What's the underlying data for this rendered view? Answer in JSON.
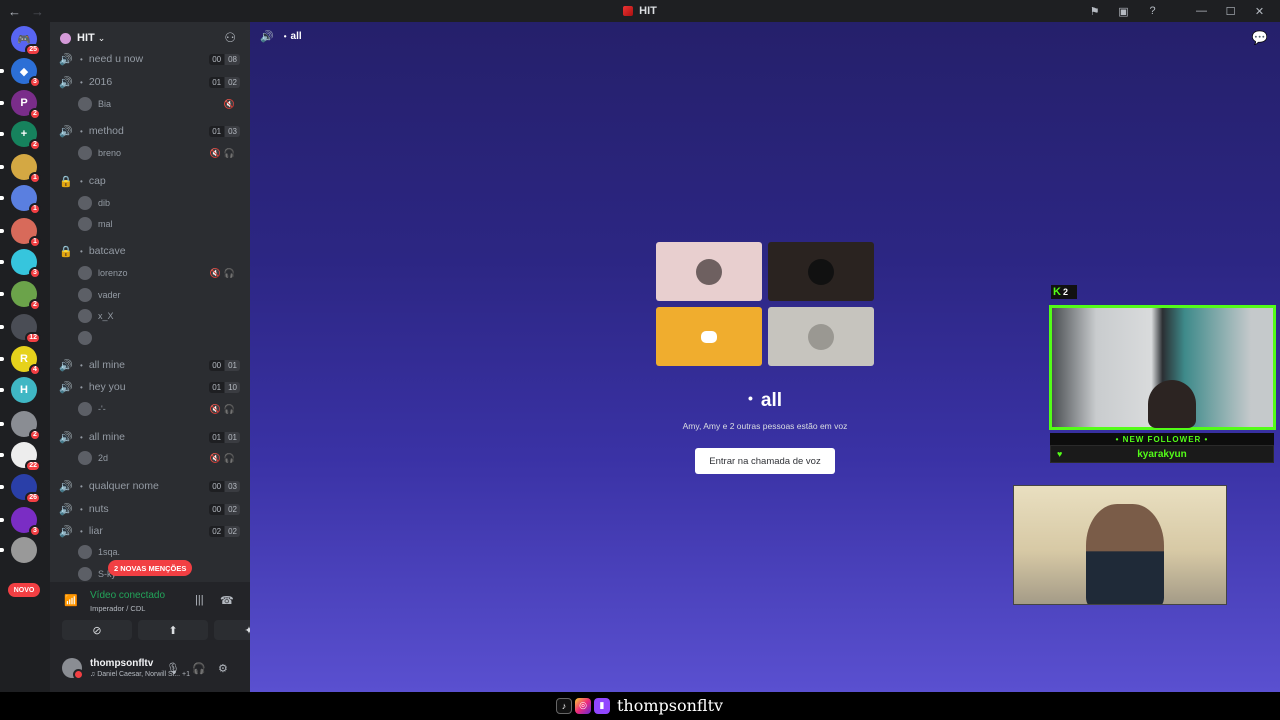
{
  "titlebar": {
    "back": "←",
    "forward": "→",
    "title": "HIT",
    "icons": [
      "inbox-flag-icon",
      "screen-icon",
      "help-icon"
    ],
    "window_controls": [
      "—",
      "☐",
      "✕"
    ]
  },
  "rail": {
    "servers": [
      {
        "name": "dm-home",
        "badge": "25",
        "color": "#5865f2",
        "glyph": "🎮"
      },
      {
        "name": "server-blue-diamond",
        "badge": "3",
        "color": "#2c6fd6",
        "glyph": "◆"
      },
      {
        "name": "server-p",
        "badge": "2",
        "color": "#7a2d8a",
        "glyph": "P"
      },
      {
        "name": "server-plus",
        "badge": "2",
        "color": "#16825d",
        "glyph": "+"
      },
      {
        "name": "server-anime-1",
        "badge": "1",
        "color": "#d4a843",
        "glyph": ""
      },
      {
        "name": "server-anime-2",
        "badge": "1",
        "color": "#5a7fe0",
        "glyph": ""
      },
      {
        "name": "server-anime-3",
        "badge": "1",
        "color": "#d86a5a",
        "glyph": ""
      },
      {
        "name": "server-cyan",
        "badge": "3",
        "color": "#36c5dd",
        "glyph": ""
      },
      {
        "name": "server-turtle",
        "badge": "2",
        "color": "#6ba34a",
        "glyph": ""
      },
      {
        "name": "server-car",
        "badge": "12",
        "color": "#4a4d55",
        "glyph": ""
      },
      {
        "name": "server-yellow-r",
        "badge": "4",
        "color": "#e6d21c",
        "glyph": "R"
      },
      {
        "name": "server-historia",
        "badge": "",
        "color": "#3fb7c4",
        "glyph": "H"
      },
      {
        "name": "server-grey",
        "badge": "2",
        "color": "#8a8d93",
        "glyph": ""
      },
      {
        "name": "server-skull",
        "badge": "22",
        "color": "#ededed",
        "glyph": ""
      },
      {
        "name": "server-mario",
        "badge": "26",
        "color": "#2a3fa8",
        "glyph": ""
      },
      {
        "name": "server-purple",
        "badge": "3",
        "color": "#7a2dc4",
        "glyph": ""
      },
      {
        "name": "server-novo",
        "badge": "",
        "color": "#999",
        "glyph": ""
      }
    ],
    "novo_label": "NOVO"
  },
  "sidebar": {
    "server_name": "HIT",
    "channels": [
      {
        "type": "voice",
        "name": "need u now",
        "counts": [
          "00",
          "08"
        ],
        "live": false
      },
      {
        "type": "voice",
        "name": "2016",
        "counts": [
          "01",
          "02"
        ],
        "live": true
      },
      {
        "type": "user",
        "name": "Bia",
        "icons": "🔇"
      },
      {
        "type": "voice",
        "name": "method",
        "counts": [
          "01",
          "03"
        ],
        "live": true
      },
      {
        "type": "user",
        "name": "breno",
        "icons": "🔇🎧"
      },
      {
        "type": "locked",
        "name": "cap"
      },
      {
        "type": "user",
        "name": "dib",
        "icons": ""
      },
      {
        "type": "user",
        "name": "mal",
        "icons": ""
      },
      {
        "type": "locked",
        "name": "batcave"
      },
      {
        "type": "user",
        "name": "lorenzo",
        "icons": "🔇🎧"
      },
      {
        "type": "user",
        "name": "vader",
        "icons": ""
      },
      {
        "type": "user",
        "name": "x_X",
        "icons": ""
      },
      {
        "type": "user",
        "name": "",
        "icons": ""
      },
      {
        "type": "voice",
        "name": "all mine",
        "counts": [
          "00",
          "01"
        ],
        "live": false
      },
      {
        "type": "voice",
        "name": "hey you",
        "counts": [
          "01",
          "10"
        ],
        "live": true
      },
      {
        "type": "user",
        "name": "-'-",
        "icons": "🔇🎧"
      },
      {
        "type": "voice",
        "name": "all mine",
        "counts": [
          "01",
          "01"
        ],
        "live": true
      },
      {
        "type": "user",
        "name": "2d",
        "icons": "🔇🎧"
      },
      {
        "type": "voice",
        "name": "qualquer nome",
        "counts": [
          "00",
          "03"
        ],
        "live": false
      },
      {
        "type": "voice",
        "name": "nuts",
        "counts": [
          "00",
          "02"
        ],
        "live": false
      },
      {
        "type": "voice",
        "name": "liar",
        "counts": [
          "02",
          "02"
        ],
        "live": true
      },
      {
        "type": "user",
        "name": "1sqa.",
        "icons": ""
      },
      {
        "type": "user",
        "name": "S-ky",
        "icons": ""
      }
    ],
    "mentions_label": "2 NOVAS MENÇÕES"
  },
  "voice_panel": {
    "status": "Vídeo conectado",
    "location": "Imperador / CDL"
  },
  "userbar": {
    "username": "thompsonfltv",
    "activity": "Daniel Caesar, Norwill Si...",
    "activity_extra": "+1"
  },
  "stage": {
    "channel_name": "all",
    "call_title": "all",
    "call_subtitle": "Amy, Amy e 2 outras pessoas estão em voz",
    "join_label": "Entrar na chamada de voz",
    "tiles": [
      {
        "name": "participant-tile-1",
        "bg": "#e8cfcf",
        "avatar": "#6e6060"
      },
      {
        "name": "participant-tile-2",
        "bg": "#2a2320",
        "avatar": "#111"
      },
      {
        "name": "participant-tile-3",
        "bg": "#f0ad2e",
        "avatar": "discord"
      },
      {
        "name": "participant-tile-4",
        "bg": "#c6c4be",
        "avatar": "#9a9892"
      }
    ]
  },
  "overlay": {
    "kick_count": "2",
    "new_follower_label": "• NEW FOLLOWER •",
    "follower_name": "kyarakyun"
  },
  "footer": {
    "handle": "thompsonfltv"
  },
  "colors": {
    "accent_green": "#23a55a",
    "danger": "#f23f43",
    "kick_green": "#53fc18"
  }
}
